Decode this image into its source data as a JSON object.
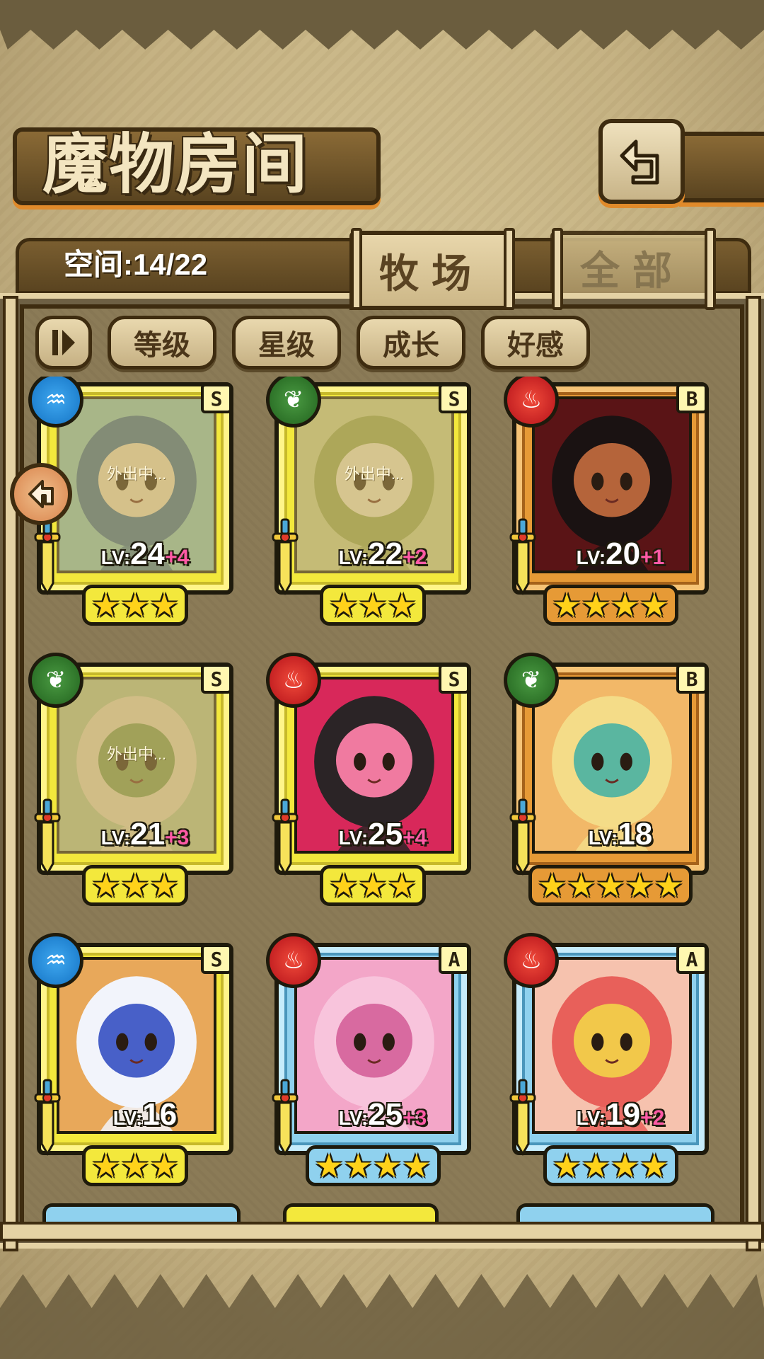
{
  "title": "魔物房间",
  "space": "空间:14/22",
  "tabs": [
    {
      "label": "牧场",
      "active": true
    },
    {
      "label": "全部",
      "active": false
    }
  ],
  "filters": [
    "等级",
    "星级",
    "成长",
    "好感"
  ],
  "away_label": "外出中...",
  "level_prefix": "LV:",
  "colors": {
    "frame_S": "#f3e83c",
    "frame_B": "#e69a36",
    "frame_A": "#8fd1ee",
    "plus": "#ff5aa6",
    "star": "#ffd21a"
  },
  "monsters": [
    {
      "element": "water",
      "rank": "S",
      "level": "24",
      "bonus": "+4",
      "stars": 3,
      "away": true,
      "palette": [
        "#8fc9c0",
        "#3c6e9a",
        "#f1e2c6"
      ]
    },
    {
      "element": "wood",
      "rank": "S",
      "level": "22",
      "bonus": "+2",
      "stars": 3,
      "away": true,
      "palette": [
        "#cfd59a",
        "#9aa85a",
        "#f3ead0"
      ]
    },
    {
      "element": "fire",
      "rank": "B",
      "level": "20",
      "bonus": "+1",
      "stars": 4,
      "away": false,
      "palette": [
        "#5a1416",
        "#1a1212",
        "#b5643a"
      ]
    },
    {
      "element": "wood",
      "rank": "S",
      "level": "21",
      "bonus": "+3",
      "stars": 3,
      "away": true,
      "palette": [
        "#b9c79a",
        "#e9d9bd",
        "#7f9c5a"
      ]
    },
    {
      "element": "fire",
      "rank": "S",
      "level": "25",
      "bonus": "+4",
      "stars": 3,
      "away": false,
      "palette": [
        "#d8285a",
        "#2b2426",
        "#f07aa0"
      ]
    },
    {
      "element": "wood",
      "rank": "B",
      "level": "18",
      "bonus": "",
      "stars": 5,
      "away": false,
      "palette": [
        "#f2b868",
        "#f4dc88",
        "#5ab6a0"
      ]
    },
    {
      "element": "water",
      "rank": "S",
      "level": "16",
      "bonus": "",
      "stars": 3,
      "away": false,
      "palette": [
        "#e8a85a",
        "#f2f4fb",
        "#4860c8"
      ]
    },
    {
      "element": "fire",
      "rank": "A",
      "level": "25",
      "bonus": "+3",
      "stars": 4,
      "away": false,
      "palette": [
        "#f3a6c8",
        "#f8c4dc",
        "#d86aa0"
      ]
    },
    {
      "element": "fire",
      "rank": "A",
      "level": "19",
      "bonus": "+2",
      "stars": 4,
      "away": false,
      "palette": [
        "#f6c2ae",
        "#e8605a",
        "#f2c84a"
      ]
    }
  ]
}
